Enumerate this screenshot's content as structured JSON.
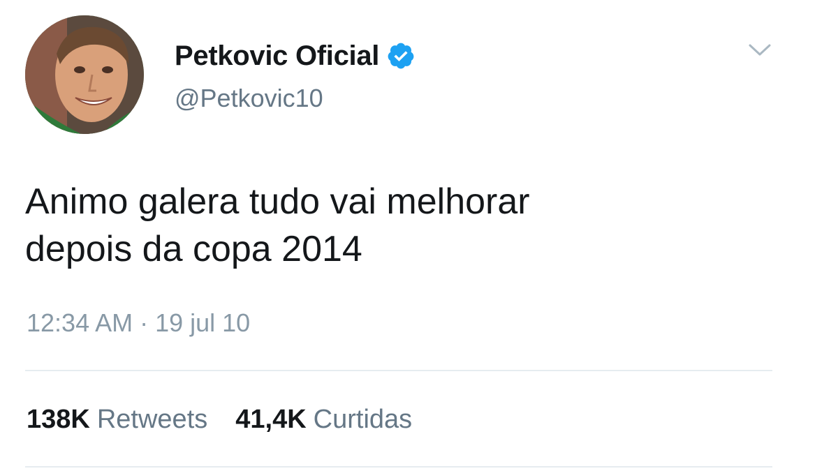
{
  "tweet": {
    "display_name": "Petkovic Oficial",
    "handle": "@Petkovic10",
    "text_line1": "Animo galera tudo vai melhorar",
    "text_line2": "depois da copa 2014",
    "timestamp": "12:34 AM · 19 jul 10",
    "stats": {
      "retweets_count": "138K",
      "retweets_label": "Retweets",
      "likes_count": "41,4K",
      "likes_label": "Curtidas"
    }
  },
  "icons": {
    "verified": "verified-badge-icon",
    "menu": "chevron-down-icon"
  },
  "colors": {
    "verified_blue": "#1da1f2",
    "secondary_text": "#657786",
    "timestamp_text": "#8899a6",
    "divider": "#e6ecf0"
  }
}
